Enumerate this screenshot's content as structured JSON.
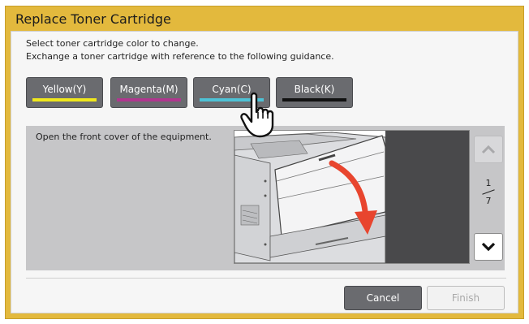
{
  "dialog": {
    "title": "Replace Toner Cartridge",
    "instruction_line1": "Select toner cartridge color to change.",
    "instruction_line2": "Exchange a toner cartridge with reference to the following guidance."
  },
  "colors": [
    {
      "label": "Yellow(Y)",
      "bar_color": "#f0e81c"
    },
    {
      "label": "Magenta(M)",
      "bar_color": "#b0378f"
    },
    {
      "label": "Cyan(C)",
      "bar_color": "#4ec2d6"
    },
    {
      "label": "Black(K)",
      "bar_color": "#111111"
    }
  ],
  "guide": {
    "step_text": "Open the front cover of the equipment.",
    "page_current": "1",
    "page_total": "7",
    "up_icon": "chevron-up-icon",
    "down_icon": "chevron-down-icon"
  },
  "footer": {
    "cancel_label": "Cancel",
    "finish_label": "Finish"
  },
  "theme": {
    "frame_color": "#e3b93d",
    "button_color": "#6a6b6f",
    "arrow_color": "#e8452e"
  }
}
